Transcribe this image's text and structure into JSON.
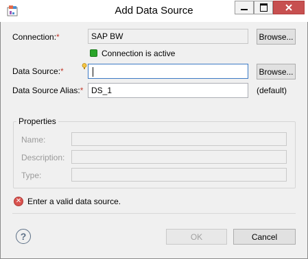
{
  "window": {
    "title": "Add Data Source",
    "minimize_icon": "minimize-icon",
    "maximize_icon": "maximize-icon",
    "close_icon": "close-icon"
  },
  "form": {
    "connection": {
      "label": "Connection:",
      "required": "*",
      "value": "SAP BW",
      "browse": "Browse..."
    },
    "connection_status": "Connection is active",
    "data_source": {
      "label": "Data Source:",
      "required": "*",
      "value": "",
      "browse": "Browse..."
    },
    "alias": {
      "label": "Data Source Alias:",
      "required": "*",
      "value": "DS_1",
      "hint": "(default)"
    }
  },
  "properties": {
    "title": "Properties",
    "name_label": "Name:",
    "description_label": "Description:",
    "type_label": "Type:"
  },
  "validation": {
    "message": "Enter a valid data source."
  },
  "footer": {
    "ok": "OK",
    "cancel": "Cancel"
  },
  "colors": {
    "status_ok": "#2aa52a",
    "error": "#d9534f",
    "accent_required": "#c0392b"
  }
}
